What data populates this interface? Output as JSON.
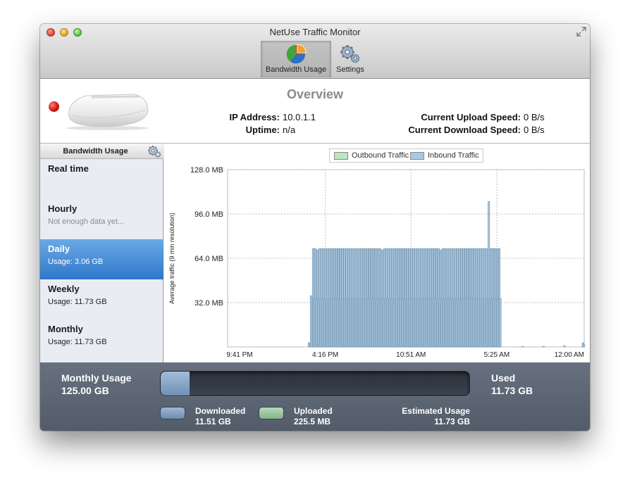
{
  "window": {
    "title": "NetUse Traffic Monitor"
  },
  "toolbar": {
    "bandwidth_label": "Bandwidth Usage",
    "settings_label": "Settings"
  },
  "overview": {
    "title": "Overview",
    "ip_label": "IP Address:",
    "ip_value": "10.0.1.1",
    "uptime_label": "Uptime:",
    "uptime_value": "n/a",
    "upload_label": "Current Upload Speed:",
    "upload_value": "0 B/s",
    "download_label": "Current Download Speed:",
    "download_value": "0 B/s",
    "status_color": "#d01810"
  },
  "sidebar": {
    "header": "Bandwidth Usage",
    "items": [
      {
        "name": "Real time",
        "sub": ""
      },
      {
        "name": "Hourly",
        "sub": "Not enough data yet..."
      },
      {
        "name": "Daily",
        "sub": "Usage: 3.06 GB"
      },
      {
        "name": "Weekly",
        "sub": "Usage: 11.73 GB"
      },
      {
        "name": "Monthly",
        "sub": "Usage: 11.73 GB"
      }
    ],
    "selected_index": 2
  },
  "legend": {
    "outbound": "Outbound Traffic",
    "inbound": "Inbound Traffic",
    "outbound_color": "#bfe3c3",
    "inbound_color": "#a9c9e2"
  },
  "chart_data": {
    "type": "bar",
    "ylabel": "Average traffic (9 min resolution)",
    "y_ticks": [
      "128.0 MB",
      "96.0 MB",
      "64.0 MB",
      "32.0 MB"
    ],
    "y_tick_values": [
      128,
      96,
      64,
      32
    ],
    "x_ticks": [
      "9:41 PM",
      "4:16 PM",
      "10:51 AM",
      "5:25 AM",
      "12:00 AM"
    ],
    "ylim": [
      0,
      128
    ],
    "grid": true,
    "series": [
      {
        "name": "Inbound Traffic",
        "values": [
          0,
          0,
          0,
          0,
          0,
          0,
          0,
          0,
          0,
          0,
          0,
          0,
          0,
          0,
          0,
          0,
          0,
          0,
          0,
          0,
          0,
          0,
          0,
          0,
          0,
          0,
          0,
          0,
          0,
          0,
          0,
          0,
          0,
          0,
          0,
          0,
          0,
          0,
          0,
          0,
          0,
          0,
          0,
          0,
          0,
          0,
          0,
          0,
          0,
          0,
          0,
          0,
          0,
          0,
          0,
          0,
          0,
          0,
          0,
          0,
          0,
          0,
          0,
          0,
          0,
          0,
          0,
          0,
          0,
          0,
          0,
          0,
          0,
          0,
          0,
          0,
          0,
          3,
          0,
          37,
          0,
          71,
          35,
          71,
          35,
          70,
          35,
          71,
          35,
          71,
          35,
          71,
          35,
          71,
          35,
          71,
          35,
          71,
          35,
          71,
          35,
          71,
          35,
          71,
          35,
          71,
          35,
          71,
          35,
          71,
          35,
          71,
          35,
          71,
          35,
          71,
          35,
          71,
          35,
          71,
          35,
          71,
          35,
          71,
          35,
          71,
          35,
          71,
          35,
          71,
          35,
          71,
          35,
          71,
          35,
          71,
          35,
          71,
          35,
          71,
          35,
          71,
          35,
          71,
          35,
          71,
          35,
          70,
          35,
          71,
          35,
          71,
          35,
          71,
          35,
          71,
          35,
          71,
          35,
          71,
          35,
          71,
          35,
          71,
          35,
          71,
          35,
          71,
          35,
          71,
          35,
          71,
          35,
          71,
          35,
          71,
          35,
          71,
          35,
          71,
          35,
          71,
          35,
          71,
          35,
          71,
          35,
          71,
          35,
          71,
          35,
          71,
          35,
          71,
          35,
          71,
          35,
          71,
          35,
          71,
          35,
          71,
          35,
          70,
          35,
          71,
          35,
          71,
          35,
          71,
          35,
          71,
          35,
          71,
          35,
          71,
          35,
          71,
          35,
          71,
          35,
          71,
          35,
          71,
          35,
          71,
          35,
          71,
          35,
          71,
          35,
          71,
          35,
          71,
          35,
          71,
          35,
          71,
          35,
          71,
          35,
          71,
          35,
          71,
          35,
          71,
          35,
          71,
          35,
          105,
          35,
          71,
          35,
          71,
          35,
          71,
          35,
          71,
          35,
          71,
          35,
          0,
          0,
          0,
          0,
          0,
          0,
          0,
          0,
          0,
          0,
          0,
          0,
          0,
          0,
          0,
          0,
          0,
          0,
          0,
          0,
          0,
          0,
          0,
          0,
          0,
          0,
          0,
          0,
          0,
          0,
          0,
          0,
          0,
          0,
          0,
          0,
          0,
          0,
          0,
          0,
          0,
          0,
          0,
          0,
          0,
          0,
          0,
          0,
          0,
          0,
          0,
          0,
          0,
          0,
          0,
          0,
          0,
          0,
          0,
          0,
          0,
          0,
          0,
          0,
          0,
          0,
          0,
          0,
          0,
          0,
          0,
          0,
          0,
          0,
          0,
          0,
          0,
          0,
          3,
          2
        ]
      },
      {
        "name": "Outbound Traffic",
        "values": [
          0.5,
          0.5,
          1
        ]
      }
    ]
  },
  "bottom": {
    "monthly_label": "Monthly Usage",
    "monthly_value": "125.00 GB",
    "used_label": "Used",
    "used_value": "11.73 GB",
    "used_fraction": 0.0938,
    "downloaded_label": "Downloaded",
    "downloaded_value": "11.51 GB",
    "uploaded_label": "Uploaded",
    "uploaded_value": "225.5 MB",
    "estimated_label": "Estimated Usage",
    "estimated_value": "11.73 GB"
  }
}
